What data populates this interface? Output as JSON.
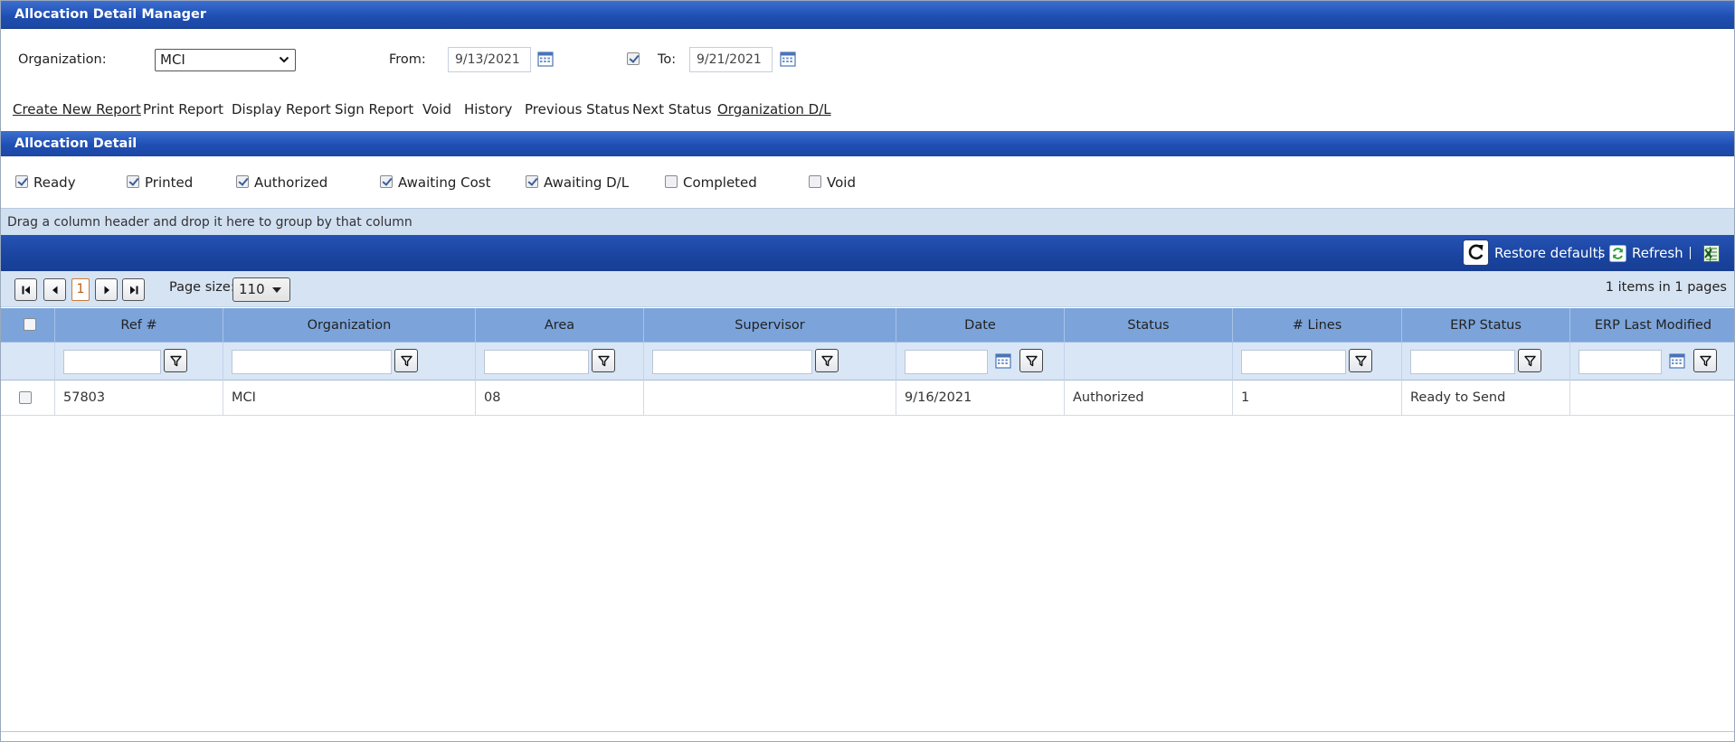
{
  "window": {
    "title": "Allocation Detail Manager"
  },
  "filters": {
    "organization_label": "Organization:",
    "organization_value": "MCI",
    "from_label": "From:",
    "from_value": "9/13/2021",
    "to_enabled": true,
    "to_label": "To:",
    "to_value": "9/21/2021"
  },
  "actions": [
    {
      "label": "Create New Report",
      "underlined": true
    },
    {
      "label": "Print Report",
      "underlined": false
    },
    {
      "label": "Display Report",
      "underlined": false
    },
    {
      "label": "Sign Report",
      "underlined": false
    },
    {
      "label": "Void",
      "underlined": false
    },
    {
      "label": "History",
      "underlined": false
    },
    {
      "label": "Previous Status",
      "underlined": false
    },
    {
      "label": "Next Status",
      "underlined": false
    },
    {
      "label": "Organization D/L",
      "underlined": true
    }
  ],
  "section": {
    "title": "Allocation Detail"
  },
  "status_filters": [
    {
      "label": "Ready",
      "checked": true
    },
    {
      "label": "Printed",
      "checked": true
    },
    {
      "label": "Authorized",
      "checked": true
    },
    {
      "label": "Awaiting Cost",
      "checked": true
    },
    {
      "label": "Awaiting D/L",
      "checked": true
    },
    {
      "label": "Completed",
      "checked": false
    },
    {
      "label": "Void",
      "checked": false
    }
  ],
  "grid": {
    "group_hint": "Drag a column header and drop it here to group by that column",
    "toolbar": {
      "restore_label": "Restore defaults",
      "refresh_label": "Refresh",
      "separator": "|"
    },
    "pager": {
      "current_page": "1",
      "page_size_label": "Page size:",
      "page_size": "110",
      "info": "1 items in 1 pages"
    },
    "columns": [
      "Ref #",
      "Organization",
      "Area",
      "Supervisor",
      "Date",
      "Status",
      "# Lines",
      "ERP Status",
      "ERP Last Modified"
    ],
    "rows": [
      {
        "checked": false,
        "cells": [
          "57803",
          "MCI",
          "08",
          "",
          "9/16/2021",
          "Authorized",
          "1",
          "Ready to Send",
          ""
        ]
      }
    ]
  },
  "icons": {
    "calendar": "calendar-icon",
    "filter": "filter-icon",
    "restore": "restore-icon",
    "refresh": "refresh-icon",
    "export": "excel-export-icon"
  },
  "colors": {
    "header_blue": "#1f4fb3",
    "column_header": "#7ca4db",
    "light_panel": "#d6e3f3",
    "current_page": "#b85d17"
  }
}
